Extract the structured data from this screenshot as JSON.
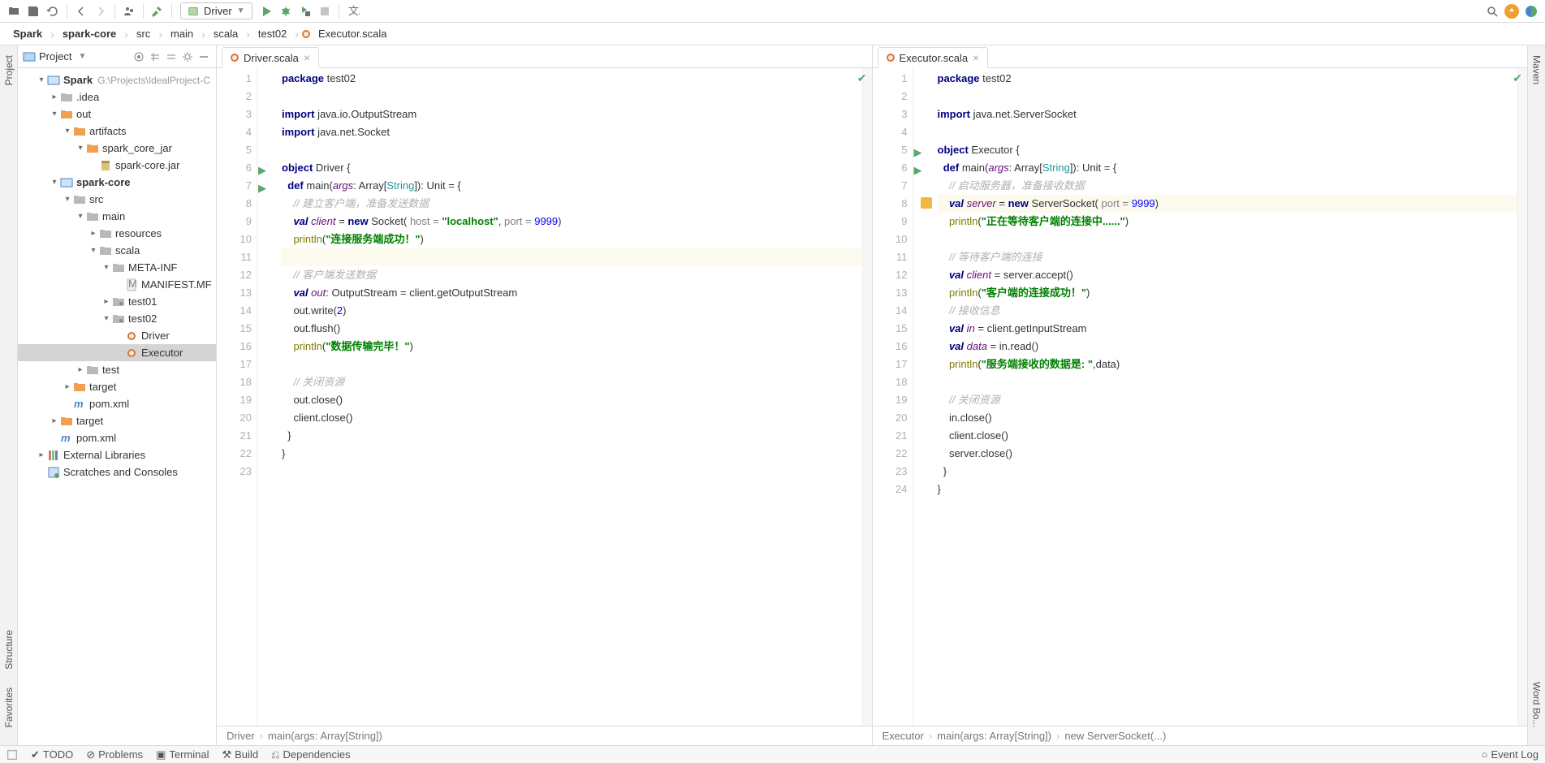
{
  "toolbar": {
    "run_config": "Driver"
  },
  "breadcrumb": [
    "Spark",
    "spark-core",
    "src",
    "main",
    "scala",
    "test02",
    "Executor.scala"
  ],
  "project": {
    "title": "Project",
    "root": {
      "name": "Spark",
      "path": "G:\\Projects\\IdealProject-C"
    },
    "tree": [
      {
        "d": 1,
        "ar": "▾",
        "k": "mod",
        "label": "Spark",
        "bold": true,
        "sub": "G:\\Projects\\IdealProject-C"
      },
      {
        "d": 2,
        "ar": "▸",
        "k": "fld",
        "label": ".idea"
      },
      {
        "d": 2,
        "ar": "▾",
        "k": "ofld",
        "label": "out"
      },
      {
        "d": 3,
        "ar": "▾",
        "k": "ofld",
        "label": "artifacts"
      },
      {
        "d": 4,
        "ar": "▾",
        "k": "ofld",
        "label": "spark_core_jar"
      },
      {
        "d": 5,
        "ar": "",
        "k": "jar",
        "label": "spark-core.jar"
      },
      {
        "d": 2,
        "ar": "▾",
        "k": "mod",
        "label": "spark-core",
        "bold": true
      },
      {
        "d": 3,
        "ar": "▾",
        "k": "fld",
        "label": "src"
      },
      {
        "d": 4,
        "ar": "▾",
        "k": "fld",
        "label": "main"
      },
      {
        "d": 5,
        "ar": "▸",
        "k": "fld",
        "label": "resources"
      },
      {
        "d": 5,
        "ar": "▾",
        "k": "fld",
        "label": "scala"
      },
      {
        "d": 6,
        "ar": "▾",
        "k": "fld",
        "label": "META-INF"
      },
      {
        "d": 7,
        "ar": "",
        "k": "mf",
        "label": "MANIFEST.MF"
      },
      {
        "d": 6,
        "ar": "▸",
        "k": "pkg",
        "label": "test01"
      },
      {
        "d": 6,
        "ar": "▾",
        "k": "pkg",
        "label": "test02"
      },
      {
        "d": 7,
        "ar": "",
        "k": "obj",
        "label": "Driver"
      },
      {
        "d": 7,
        "ar": "",
        "k": "obj",
        "label": "Executor",
        "sel": true
      },
      {
        "d": 4,
        "ar": "▸",
        "k": "fld",
        "label": "test"
      },
      {
        "d": 3,
        "ar": "▸",
        "k": "ofld",
        "label": "target"
      },
      {
        "d": 3,
        "ar": "",
        "k": "pom",
        "label": "pom.xml"
      },
      {
        "d": 2,
        "ar": "▸",
        "k": "ofld",
        "label": "target"
      },
      {
        "d": 2,
        "ar": "",
        "k": "pom",
        "label": "pom.xml"
      },
      {
        "d": 1,
        "ar": "▸",
        "k": "lib",
        "label": "External Libraries"
      },
      {
        "d": 1,
        "ar": "",
        "k": "scr",
        "label": "Scratches and Consoles"
      }
    ]
  },
  "editors": [
    {
      "tab": "Driver.scala",
      "crumbs": [
        "Driver",
        "main(args: Array[String])"
      ],
      "lines": [
        {
          "n": 1,
          "html": "<span class='kw2'>package</span> test02"
        },
        {
          "n": 2,
          "html": ""
        },
        {
          "n": 3,
          "html": "<span class='kw2'>import</span> java.io.OutputStream"
        },
        {
          "n": 4,
          "html": "<span class='kw2'>import</span> java.net.Socket"
        },
        {
          "n": 5,
          "html": ""
        },
        {
          "n": 6,
          "run": true,
          "html": "<span class='kw2'>object</span> Driver {"
        },
        {
          "n": 7,
          "run": true,
          "html": "  <span class='kw2'>def</span> main(<span class='ident'>args</span>: Array[<span class='type'>String</span>]): Unit = {"
        },
        {
          "n": 8,
          "html": "    <span class='comment'>// 建立客户端，准备发送数据</span>"
        },
        {
          "n": 9,
          "html": "    <span class='kw'>val</span> <span class='ident'>client</span> = <span class='kw2'>new</span> Socket( <span class='param'>host =</span> <span class='str'>\"localhost\"</span>, <span class='param'>port =</span> <span class='num'>9999</span>)"
        },
        {
          "n": 10,
          "html": "    <span class='ann'>println</span>(<span class='str'>\"连接服务端成功！\"</span>)"
        },
        {
          "n": 11,
          "hl": true,
          "html": ""
        },
        {
          "n": 12,
          "html": "    <span class='comment'>// 客户端发送数据</span>"
        },
        {
          "n": 13,
          "html": "    <span class='kw'>val</span> <span class='ident'>out</span>: OutputStream = client.getOutputStream"
        },
        {
          "n": 14,
          "html": "    out.write(<span class='num'>2</span>)"
        },
        {
          "n": 15,
          "html": "    out.flush()"
        },
        {
          "n": 16,
          "html": "    <span class='ann'>println</span>(<span class='str'>\"数据传输完毕！\"</span>)"
        },
        {
          "n": 17,
          "html": ""
        },
        {
          "n": 18,
          "html": "    <span class='comment'>// 关闭资源</span>"
        },
        {
          "n": 19,
          "html": "    out.close()"
        },
        {
          "n": 20,
          "html": "    client.close()"
        },
        {
          "n": 21,
          "html": "  }"
        },
        {
          "n": 22,
          "html": "}"
        },
        {
          "n": 23,
          "html": ""
        }
      ]
    },
    {
      "tab": "Executor.scala",
      "crumbs": [
        "Executor",
        "main(args: Array[String])",
        "new ServerSocket(...)"
      ],
      "lines": [
        {
          "n": 1,
          "html": "<span class='kw2'>package</span> test02"
        },
        {
          "n": 2,
          "html": ""
        },
        {
          "n": 3,
          "html": "<span class='kw2'>import</span> java.net.ServerSocket"
        },
        {
          "n": 4,
          "html": ""
        },
        {
          "n": 5,
          "run": true,
          "html": "<span class='kw2'>object</span> Executor {"
        },
        {
          "n": 6,
          "run": true,
          "html": "  <span class='kw2'>def</span> main(<span class='ident'>args</span>: Array[<span class='type'>String</span>]): Unit = {"
        },
        {
          "n": 7,
          "html": "    <span class='comment'>// 启动服务器，准备接收数据</span>"
        },
        {
          "n": 8,
          "hl": true,
          "bulb": true,
          "html": "    <span class='kw'>val</span> <span class='ident'>server</span> = <span class='kw2'>new</span> ServerSocket( <span class='param'>port =</span> <span class='num'>9999</span>)"
        },
        {
          "n": 9,
          "html": "    <span class='ann'>println</span>(<span class='str'>\"正在等待客户端的连接中......\"</span>)"
        },
        {
          "n": 10,
          "html": ""
        },
        {
          "n": 11,
          "html": "    <span class='comment'>// 等待客户端的连接</span>"
        },
        {
          "n": 12,
          "html": "    <span class='kw'>val</span> <span class='ident'>client</span> = server.accept()"
        },
        {
          "n": 13,
          "html": "    <span class='ann'>println</span>(<span class='str'>\"客户端的连接成功！\"</span>)"
        },
        {
          "n": 14,
          "html": "    <span class='comment'>// 接收信息</span>"
        },
        {
          "n": 15,
          "html": "    <span class='kw'>val</span> <span class='ident'>in</span> = client.getInputStream"
        },
        {
          "n": 16,
          "html": "    <span class='kw'>val</span> <span class='ident'>data</span> = in.read()"
        },
        {
          "n": 17,
          "html": "    <span class='ann'>println</span>(<span class='str'>\"服务端接收的数据是: \"</span>,data)"
        },
        {
          "n": 18,
          "html": ""
        },
        {
          "n": 19,
          "html": "    <span class='comment'>// 关闭资源</span>"
        },
        {
          "n": 20,
          "html": "    in.close()"
        },
        {
          "n": 21,
          "html": "    client.close()"
        },
        {
          "n": 22,
          "html": "    server.close()"
        },
        {
          "n": 23,
          "html": "  }"
        },
        {
          "n": 24,
          "html": "}"
        }
      ]
    }
  ],
  "left_strip": [
    "Project",
    "Structure",
    "Favorites"
  ],
  "right_strip": [
    "Maven",
    "Word Bo..."
  ],
  "bottom": {
    "items": [
      "TODO",
      "Problems",
      "Terminal",
      "Build",
      "Dependencies"
    ],
    "event_log": "Event Log"
  }
}
